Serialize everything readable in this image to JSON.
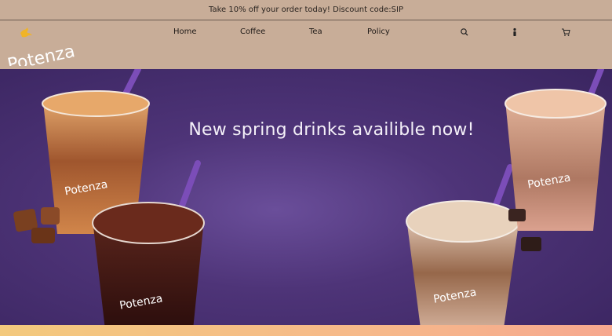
{
  "promo": {
    "text": "Take 10% off your order today! Discount code:SIP"
  },
  "brand": {
    "name": "Potenza"
  },
  "nav": {
    "items": [
      {
        "label": "Home"
      },
      {
        "label": "Coffee"
      },
      {
        "label": "Tea"
      },
      {
        "label": "Policy"
      }
    ]
  },
  "header_icons": [
    "search-icon",
    "account-icon",
    "cart-icon"
  ],
  "hero": {
    "headline": "New spring drinks availible now!",
    "cup_brand": "Potenza"
  },
  "colors": {
    "header_bg": "#c8ad98",
    "hero_bg": "#4e3478",
    "straw": "#7b4db8",
    "band_start": "#f3c97d",
    "band_end": "#f6a88f"
  }
}
